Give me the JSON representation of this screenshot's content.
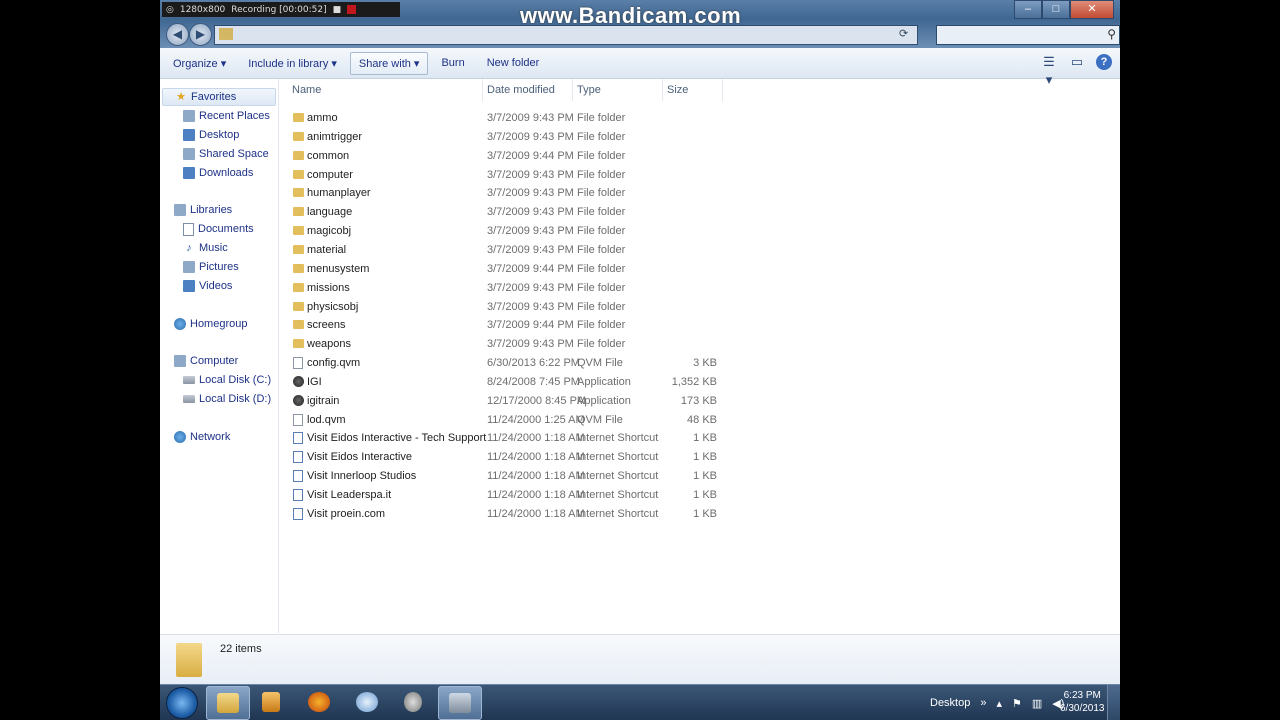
{
  "recorder": {
    "resolution": "1280x800",
    "status": "Recording [00:00:52]"
  },
  "watermark": "www.Bandicam.com",
  "toolbar": {
    "organize": "Organize",
    "include_in_library": "Include in library",
    "share_with": "Share with",
    "burn": "Burn",
    "new_folder": "New folder"
  },
  "nav": {
    "favorites": {
      "label": "Favorites",
      "items": [
        "Recent Places",
        "Desktop",
        "Shared Space",
        "Downloads"
      ]
    },
    "libraries": {
      "label": "Libraries",
      "items": [
        "Documents",
        "Music",
        "Pictures",
        "Videos"
      ]
    },
    "homegroup": "Homegroup",
    "computer": {
      "label": "Computer",
      "items": [
        "Local Disk (C:)",
        "Local Disk (D:)"
      ]
    },
    "network": "Network"
  },
  "columns": {
    "name": "Name",
    "date": "Date modified",
    "type": "Type",
    "size": "Size"
  },
  "files": [
    {
      "name": "ammo",
      "date": "3/7/2009 9:43 PM",
      "type": "File folder",
      "size": "",
      "kind": "folder"
    },
    {
      "name": "animtrigger",
      "date": "3/7/2009 9:43 PM",
      "type": "File folder",
      "size": "",
      "kind": "folder"
    },
    {
      "name": "common",
      "date": "3/7/2009 9:44 PM",
      "type": "File folder",
      "size": "",
      "kind": "folder"
    },
    {
      "name": "computer",
      "date": "3/7/2009 9:43 PM",
      "type": "File folder",
      "size": "",
      "kind": "folder"
    },
    {
      "name": "humanplayer",
      "date": "3/7/2009 9:43 PM",
      "type": "File folder",
      "size": "",
      "kind": "folder"
    },
    {
      "name": "language",
      "date": "3/7/2009 9:43 PM",
      "type": "File folder",
      "size": "",
      "kind": "folder"
    },
    {
      "name": "magicobj",
      "date": "3/7/2009 9:43 PM",
      "type": "File folder",
      "size": "",
      "kind": "folder"
    },
    {
      "name": "material",
      "date": "3/7/2009 9:43 PM",
      "type": "File folder",
      "size": "",
      "kind": "folder"
    },
    {
      "name": "menusystem",
      "date": "3/7/2009 9:44 PM",
      "type": "File folder",
      "size": "",
      "kind": "folder"
    },
    {
      "name": "missions",
      "date": "3/7/2009 9:43 PM",
      "type": "File folder",
      "size": "",
      "kind": "folder"
    },
    {
      "name": "physicsobj",
      "date": "3/7/2009 9:43 PM",
      "type": "File folder",
      "size": "",
      "kind": "folder"
    },
    {
      "name": "screens",
      "date": "3/7/2009 9:44 PM",
      "type": "File folder",
      "size": "",
      "kind": "folder"
    },
    {
      "name": "weapons",
      "date": "3/7/2009 9:43 PM",
      "type": "File folder",
      "size": "",
      "kind": "folder"
    },
    {
      "name": "config.qvm",
      "date": "6/30/2013 6:22 PM",
      "type": "QVM File",
      "size": "3 KB",
      "kind": "file"
    },
    {
      "name": "IGI",
      "date": "8/24/2008 7:45 PM",
      "type": "Application",
      "size": "1,352 KB",
      "kind": "app"
    },
    {
      "name": "igitrain",
      "date": "12/17/2000 8:45 PM",
      "type": "Application",
      "size": "173 KB",
      "kind": "app"
    },
    {
      "name": "lod.qvm",
      "date": "11/24/2000 1:25 AM",
      "type": "QVM File",
      "size": "48 KB",
      "kind": "file"
    },
    {
      "name": "Visit Eidos Interactive - Tech Support",
      "date": "11/24/2000 1:18 AM",
      "type": "Internet Shortcut",
      "size": "1 KB",
      "kind": "link"
    },
    {
      "name": "Visit Eidos Interactive",
      "date": "11/24/2000 1:18 AM",
      "type": "Internet Shortcut",
      "size": "1 KB",
      "kind": "link"
    },
    {
      "name": "Visit Innerloop Studios",
      "date": "11/24/2000 1:18 AM",
      "type": "Internet Shortcut",
      "size": "1 KB",
      "kind": "link"
    },
    {
      "name": "Visit Leaderspa.it",
      "date": "11/24/2000 1:18 AM",
      "type": "Internet Shortcut",
      "size": "1 KB",
      "kind": "link"
    },
    {
      "name": "Visit proein.com",
      "date": "11/24/2000 1:18 AM",
      "type": "Internet Shortcut",
      "size": "1 KB",
      "kind": "link"
    }
  ],
  "details": {
    "count": "22 items"
  },
  "taskbar": {
    "desktop_label": "Desktop",
    "time": "6:23 PM",
    "date": "6/30/2013"
  }
}
